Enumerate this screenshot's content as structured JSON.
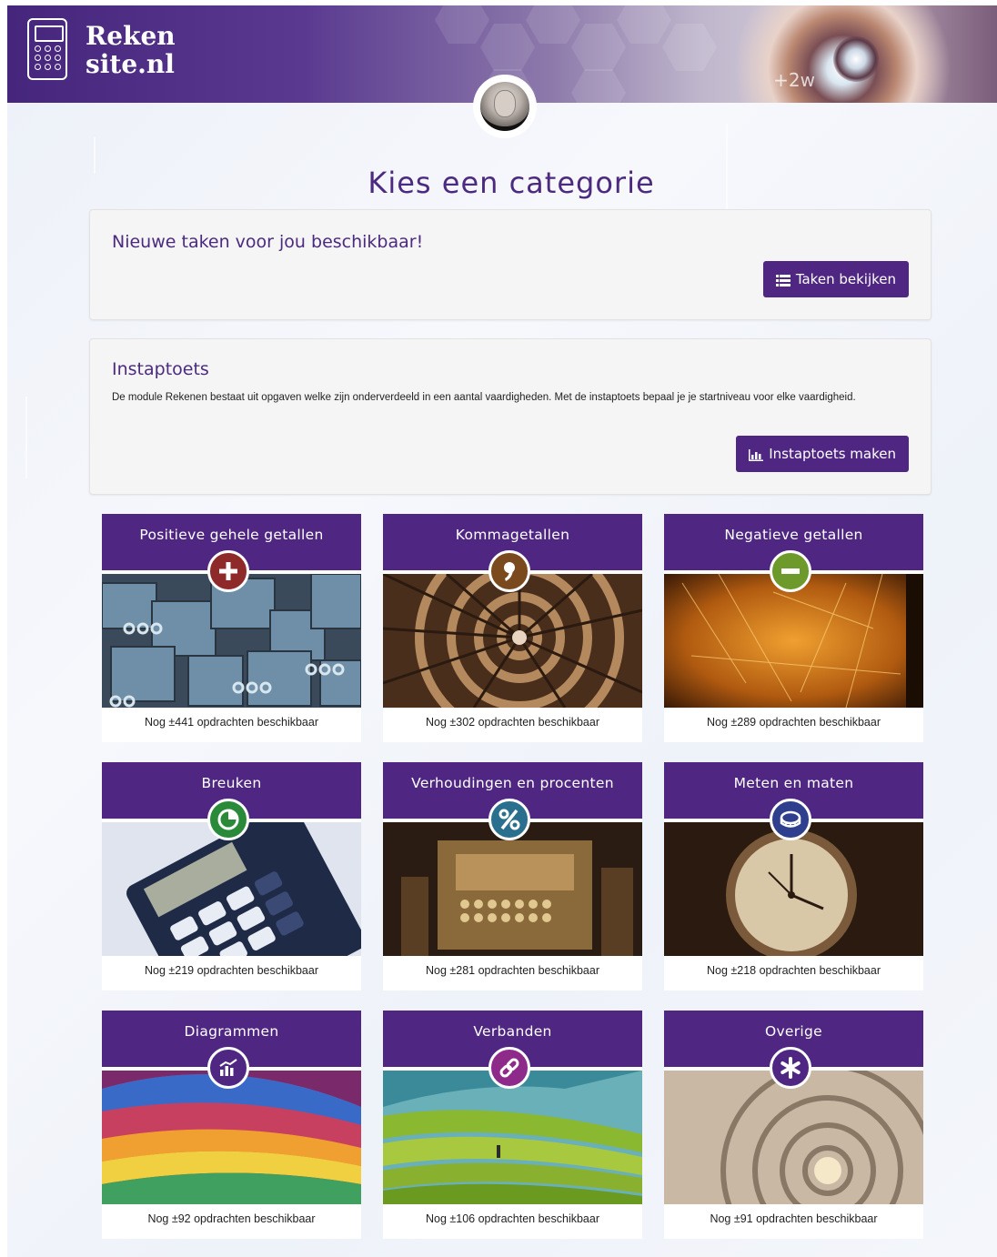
{
  "header": {
    "logo_line1": "Reken",
    "logo_line2": "site.nl",
    "banner_text": "+2w"
  },
  "page_title": "Kies een categorie",
  "tasks_panel": {
    "title": "Nieuwe taken voor jou beschikbaar!",
    "button_label": "Taken bekijken",
    "button_icon": "list-icon"
  },
  "instaptoets_panel": {
    "title": "Instaptoets",
    "text": "De module Rekenen bestaat uit opgaven welke zijn onderverdeeld in een aantal vaardigheden. Met de instaptoets bepaal je je startniveau voor elke vaardigheid.",
    "button_label": "Instaptoets maken",
    "button_icon": "bar-chart-icon"
  },
  "categories": [
    {
      "title": "Positieve gehele getallen",
      "footer": "Nog ±441 opdrachten beschikbaar",
      "icon": "plus-icon",
      "icon_color": "#8e2a2a"
    },
    {
      "title": "Kommagetallen",
      "footer": "Nog ±302 opdrachten beschikbaar",
      "icon": "comma-icon",
      "icon_color": "#7a4a1e"
    },
    {
      "title": "Negatieve getallen",
      "footer": "Nog ±289 opdrachten beschikbaar",
      "icon": "minus-icon",
      "icon_color": "#6d9a2a"
    },
    {
      "title": "Breuken",
      "footer": "Nog ±219 opdrachten beschikbaar",
      "icon": "pie-icon",
      "icon_color": "#2a8a3a"
    },
    {
      "title": "Verhoudingen en procenten",
      "footer": "Nog ±281 opdrachten beschikbaar",
      "icon": "percent-icon",
      "icon_color": "#2a6f8e"
    },
    {
      "title": "Meten en maten",
      "footer": "Nog ±218 opdrachten beschikbaar",
      "icon": "measuring-tape-icon",
      "icon_color": "#2f3f8e"
    },
    {
      "title": "Diagrammen",
      "footer": "Nog ±92 opdrachten beschikbaar",
      "icon": "chart-icon",
      "icon_color": "#4f2783"
    },
    {
      "title": "Verbanden",
      "footer": "Nog ±106 opdrachten beschikbaar",
      "icon": "link-icon",
      "icon_color": "#8e2a8a"
    },
    {
      "title": "Overige",
      "footer": "Nog ±91 opdrachten beschikbaar",
      "icon": "asterisk-icon",
      "icon_color": "#4f2783"
    }
  ]
}
